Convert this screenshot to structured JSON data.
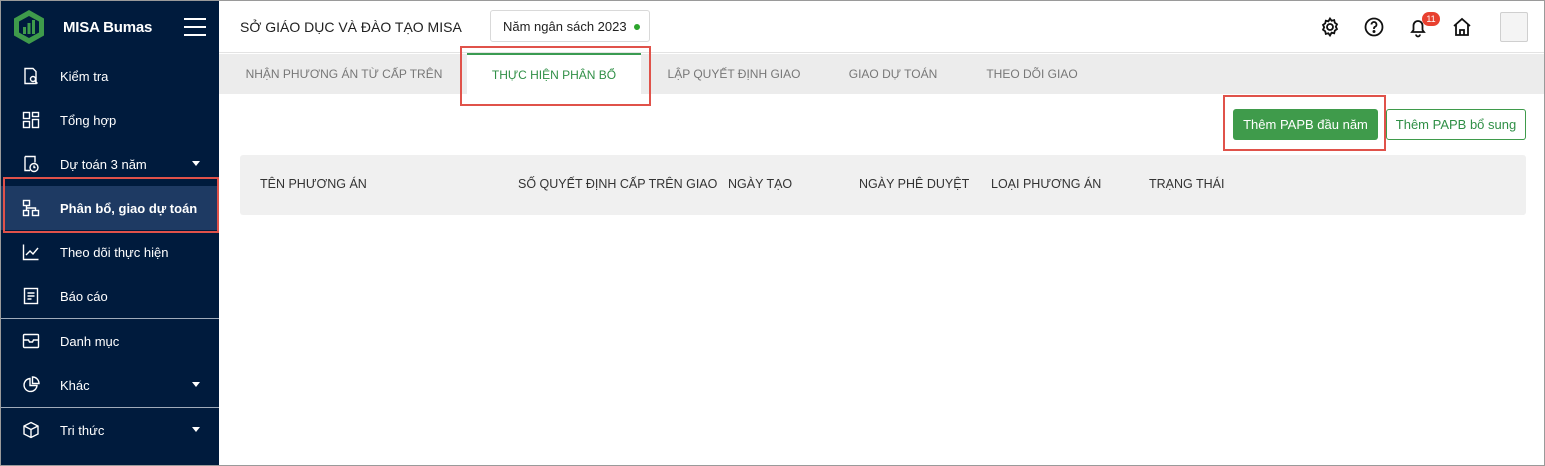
{
  "app": {
    "name": "MISA Bumas"
  },
  "sidebar": {
    "items": [
      {
        "label": "Kiểm tra",
        "icon": "check-document-icon"
      },
      {
        "label": "Tổng hợp",
        "icon": "dashboard-grid-icon"
      },
      {
        "label": "Dự toán 3 năm",
        "icon": "clock-document-icon"
      },
      {
        "label": "Phân bổ, giao dự toán",
        "icon": "hierarchy-icon"
      },
      {
        "label": "Theo dõi thực hiện",
        "icon": "line-chart-icon"
      },
      {
        "label": "Báo cáo",
        "icon": "report-icon"
      },
      {
        "label": "Danh mục",
        "icon": "inbox-icon"
      },
      {
        "label": "Khác",
        "icon": "pie-chart-icon"
      },
      {
        "label": "Tri thức",
        "icon": "cube-icon"
      }
    ],
    "active_index": 3
  },
  "header": {
    "org_title": "SỞ GIÁO DỤC VÀ ĐÀO TẠO MISA",
    "year_select": "Năm ngân sách 2023",
    "notification_count": "11"
  },
  "tabs": [
    {
      "label": "NHẬN PHƯƠNG ÁN TỪ CẤP TRÊN"
    },
    {
      "label": "THỰC HIỆN PHÂN BỔ"
    },
    {
      "label": "LẬP QUYẾT ĐỊNH GIAO"
    },
    {
      "label": "GIAO DỰ TOÁN"
    },
    {
      "label": "THEO DÕI GIAO"
    }
  ],
  "actions": {
    "add_initial": "Thêm PAPB đầu năm",
    "add_supplement": "Thêm PAPB bổ sung"
  },
  "table": {
    "columns": [
      "TÊN PHƯƠNG ÁN",
      "SỐ QUYẾT ĐỊNH CẤP TRÊN GIAO",
      "NGÀY TẠO",
      "NGÀY PHÊ DUYỆT",
      "LOẠI PHƯƠNG ÁN",
      "TRẠNG THÁI"
    ]
  },
  "colors": {
    "sidebar_bg": "#001b3d",
    "sidebar_active": "#1e3a63",
    "brand_green": "#3f9b4b",
    "highlight_red": "#e0524a",
    "badge_red": "#e8402f"
  }
}
